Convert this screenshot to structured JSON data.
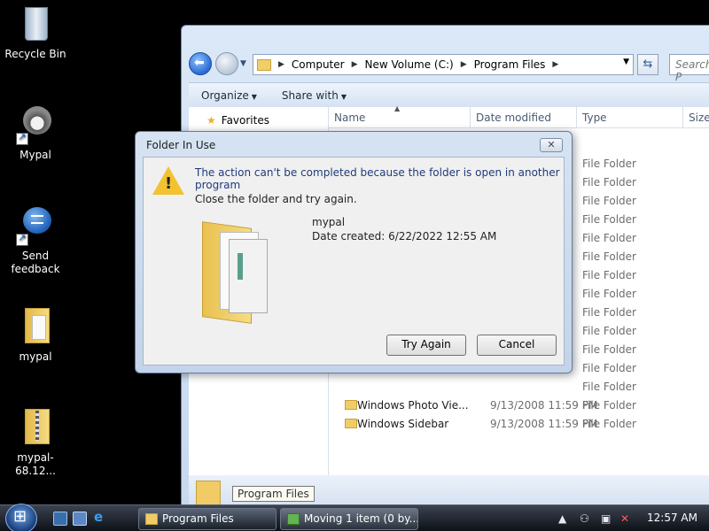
{
  "desktop": {
    "icons": [
      {
        "label": "Recycle Bin"
      },
      {
        "label": "Mypal"
      },
      {
        "label": "Send feedback"
      },
      {
        "label": "mypal"
      },
      {
        "label": "mypal-68.12..."
      }
    ]
  },
  "explorer": {
    "breadcrumb": [
      "Computer",
      "New Volume (C:)",
      "Program Files"
    ],
    "search_placeholder": "Search P",
    "commands": [
      "Organize",
      "Share with"
    ],
    "nav": {
      "favorites": "Favorites"
    },
    "columns": [
      "Name",
      "Date modified",
      "Type",
      "Size"
    ],
    "type_column_values": [
      "File Folder",
      "File Folder",
      "File Folder",
      "File Folder",
      "File Folder",
      "File Folder",
      "File Folder",
      "File Folder",
      "File Folder",
      "File Folder",
      "File Folder",
      "File Folder",
      "File Folder",
      "File Folder",
      "File Folder"
    ],
    "rows": [
      {
        "name": "Windows Photo Vie...",
        "date": "9/13/2008 11:59 PM",
        "type": "File Folder"
      },
      {
        "name": "Windows Sidebar",
        "date": "9/13/2008 11:59 PM",
        "type": "File Folder"
      }
    ],
    "details_text": "",
    "tooltip": "Program Files"
  },
  "dialog": {
    "title": "Folder In Use",
    "close_glyph": "✕",
    "message": "The action can't be completed because the folder is open in another program",
    "submessage": "Close the folder and try again.",
    "folder_name": "mypal",
    "date_created": "Date created: 6/22/2022 12:55 AM",
    "try_again_label": "Try Again",
    "cancel_label": "Cancel"
  },
  "taskbar": {
    "tasks": [
      {
        "label": "Program Files"
      },
      {
        "label": "Moving 1 item (0 by..."
      }
    ],
    "clock": "12:57 AM"
  },
  "colors": {
    "accent": "#1f3b7a",
    "folder": "#f1cc66",
    "warning": "#f2c230"
  }
}
